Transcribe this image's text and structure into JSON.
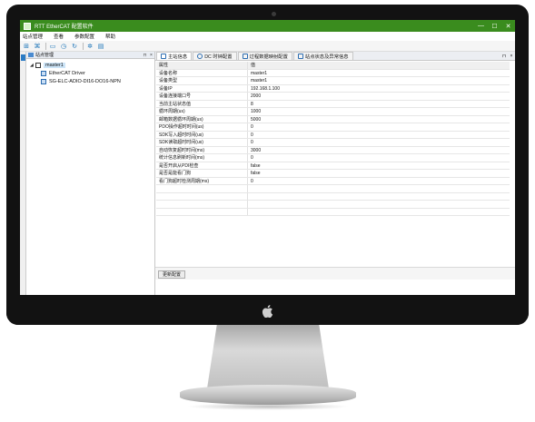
{
  "window": {
    "title": "RTT EtherCAT 配置软件",
    "controls": {
      "minimize": "—",
      "maximize": "☐",
      "close": "✕"
    }
  },
  "menu": [
    "站点管理",
    "查看",
    "参数配置",
    "帮助"
  ],
  "toolbar_icons": [
    "scan-icon",
    "network-icon",
    "monitor-icon",
    "clock-icon",
    "refresh-icon",
    "settings-icon",
    "device-icon"
  ],
  "left_panel": {
    "title": "站点管理",
    "buttons": {
      "pin": "⊓",
      "close": "×"
    },
    "tree": {
      "root": "master1",
      "children": [
        "EtherCAT Driver",
        "SG-ELC-ADIO-DI16-DO16-NPN"
      ]
    }
  },
  "tabs": [
    "主站信息",
    "DC 时钟配置",
    "过程数据映射配置",
    "站点状态及异常信息"
  ],
  "tab_controls": {
    "pin": "⊓",
    "close": "×"
  },
  "table": {
    "headers": [
      "属性",
      "值"
    ],
    "rows": [
      [
        "设备名称",
        "master1"
      ],
      [
        "设备类型",
        "master1"
      ],
      [
        "设备IP",
        "192.168.1.100"
      ],
      [
        "设备连接端口号",
        "2000"
      ],
      [
        "当前主站状态值",
        "8"
      ],
      [
        "循环周期(us)",
        "1000"
      ],
      [
        "邮箱数据循环周期(us)",
        "5000"
      ],
      [
        "PDO操作超时时间(us)",
        "0"
      ],
      [
        "SDK写入超时时间(us)",
        "0"
      ],
      [
        "SDK读取超时时间(us)",
        "0"
      ],
      [
        "自动恢复超时时间(ms)",
        "3000"
      ],
      [
        "统计信息刷新时间(ms)",
        "0"
      ],
      [
        "是否开启从PDI检查",
        "false"
      ],
      [
        "是否是能看门狗",
        "false"
      ],
      [
        "看门狗超时检测周期(ms)",
        "0"
      ]
    ]
  },
  "update_button": "更新配置",
  "colors": {
    "titlebar": "#3a8c1e",
    "selection": "#cce4f7"
  }
}
